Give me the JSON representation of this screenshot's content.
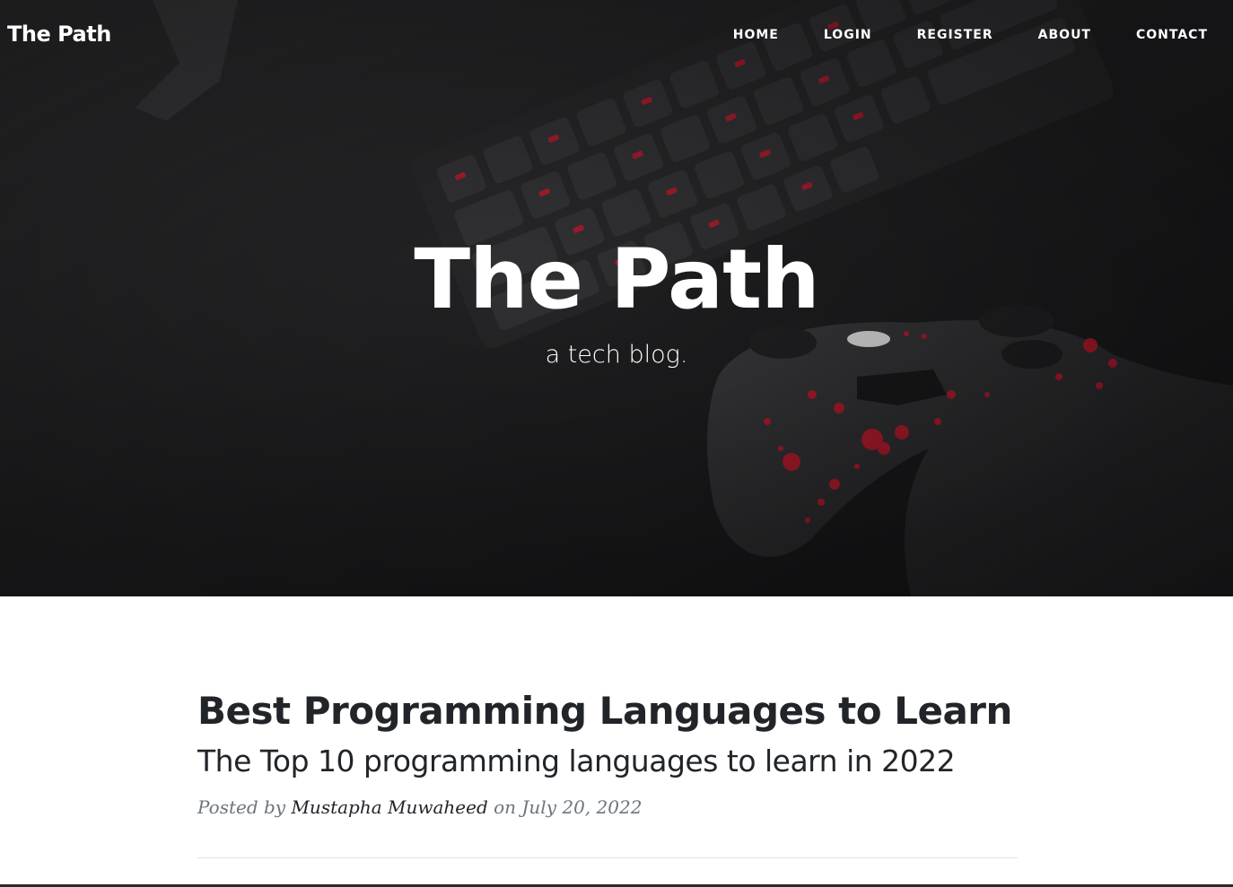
{
  "site": {
    "brand": "The Path"
  },
  "nav": {
    "items": [
      {
        "label": "HOME"
      },
      {
        "label": "LOGIN"
      },
      {
        "label": "REGISTER"
      },
      {
        "label": "ABOUT"
      },
      {
        "label": "CONTACT"
      }
    ]
  },
  "hero": {
    "title": "The Path",
    "subtitle": "a tech blog."
  },
  "posts": [
    {
      "title": "Best Programming Languages to Learn",
      "subtitle": "The Top 10 programming languages to learn in 2022",
      "meta_prefix": "Posted by",
      "author": "Mustapha Muwaheed",
      "meta_on": "on",
      "date": "July 20, 2022"
    }
  ],
  "colors": {
    "hero_background": "#1a1a1c",
    "accent_red": "#c0182a",
    "text_dark": "#212529",
    "text_muted": "#6c757d"
  }
}
